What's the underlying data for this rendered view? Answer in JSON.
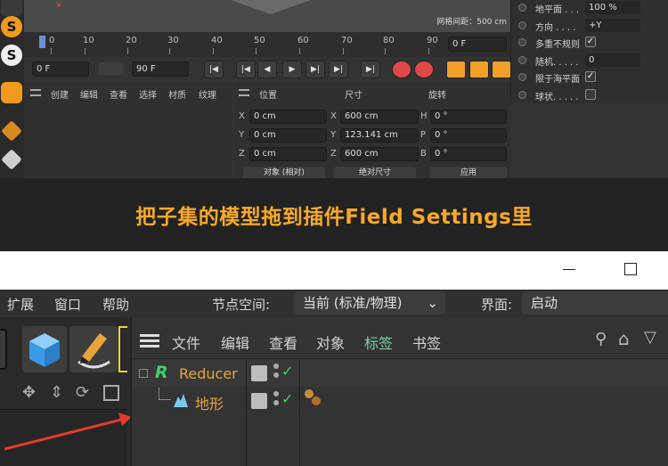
{
  "top": {
    "grid_spacing": "网格间距：500 cm",
    "timeline_ticks": [
      "0",
      "10",
      "20",
      "30",
      "40",
      "50",
      "60",
      "70",
      "80",
      "90"
    ],
    "timeline_end_field": "0 F",
    "start_frame": "0 F",
    "end_frame": "90 F",
    "object_menu": [
      "创建",
      "编辑",
      "查看",
      "选择",
      "材质",
      "纹理"
    ],
    "coord_headers": {
      "position": "位置",
      "size": "尺寸",
      "rotation": "旋转"
    },
    "coord_rows": [
      {
        "axis": "X",
        "pos": "0 cm",
        "size_axis": "X",
        "size": "600 cm",
        "rot_axis": "H",
        "rot": "0 °"
      },
      {
        "axis": "Y",
        "pos": "0 cm",
        "size_axis": "Y",
        "size": "123.141 cm",
        "rot_axis": "P",
        "rot": "0 °"
      },
      {
        "axis": "Z",
        "pos": "0 cm",
        "size_axis": "Z",
        "size": "600 cm",
        "rot_axis": "B",
        "rot": "0 °"
      }
    ],
    "coord_dropdowns": {
      "mode": "对象 (相对)",
      "size_mode": "绝对尺寸",
      "apply": "应用"
    },
    "attributes": [
      {
        "label": "地平面 . . .",
        "value": "100 %",
        "type": "field"
      },
      {
        "label": "方向 . . . .",
        "value": "+Y",
        "type": "field"
      },
      {
        "label": "多重不规则",
        "value": "✓",
        "type": "check"
      },
      {
        "label": "随机. . . . .",
        "value": "0",
        "type": "field"
      },
      {
        "label": "限于海平面",
        "value": "✓",
        "type": "check"
      },
      {
        "label": "球状. . . . .",
        "value": "",
        "type": "check"
      }
    ]
  },
  "caption": "把子集的模型拖到插件Field Settings里",
  "menubar": {
    "items": [
      "扩展",
      "窗口",
      "帮助"
    ],
    "node_space_label": "节点空间:",
    "node_space_value": "当前 (标准/物理)",
    "interface_label": "界面:",
    "interface_value": "启动"
  },
  "object_manager": {
    "menu": [
      "文件",
      "编辑",
      "查看",
      "对象",
      "标签",
      "书签"
    ],
    "objects": [
      {
        "name": "Reducer",
        "icon": "R"
      },
      {
        "name": "地形",
        "icon": ""
      }
    ]
  },
  "colors": {
    "accent": "#f7a928",
    "object_orange": "#e8a33d",
    "check_green": "#3fd067"
  }
}
